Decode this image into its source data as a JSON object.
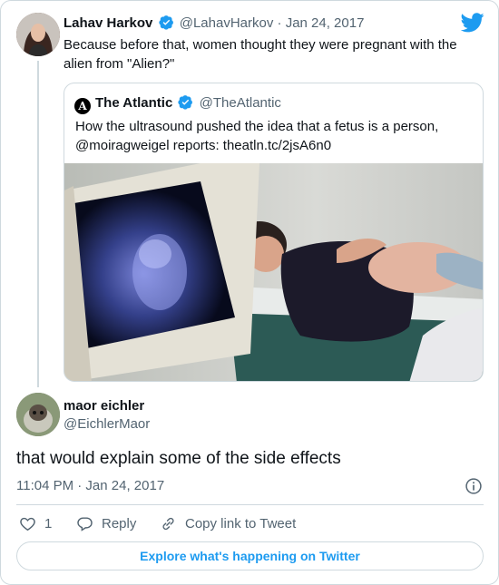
{
  "parent_tweet": {
    "display_name": "Lahav Harkov",
    "handle": "@LahavHarkov",
    "separator": "·",
    "date": "Jan 24, 2017",
    "text": "Because before that, women thought they were pregnant with the alien from \"Alien?\""
  },
  "quoted_tweet": {
    "logo_letter": "A",
    "display_name": "The Atlantic",
    "handle": "@TheAtlantic",
    "text": "How the ultrasound pushed the idea that a fetus is a person, @moiragweigel reports: theatln.tc/2jsA6n0"
  },
  "reply_tweet": {
    "display_name": "maor eichler",
    "handle": "@EichlerMaor",
    "text": "that would explain some of the side effects",
    "timestamp": "11:04 PM · Jan 24, 2017"
  },
  "actions": {
    "like_count": "1",
    "reply_label": "Reply",
    "copy_link_label": "Copy link to Tweet"
  },
  "explore_label": "Explore what's happening on Twitter",
  "colors": {
    "accent": "#1d9bf0",
    "text": "#0f1419",
    "muted": "#536471",
    "border": "#cfd9de"
  },
  "icons": [
    "verified-badge-icon",
    "twitter-bird-icon",
    "info-icon",
    "heart-icon",
    "reply-bubble-icon",
    "link-icon"
  ]
}
